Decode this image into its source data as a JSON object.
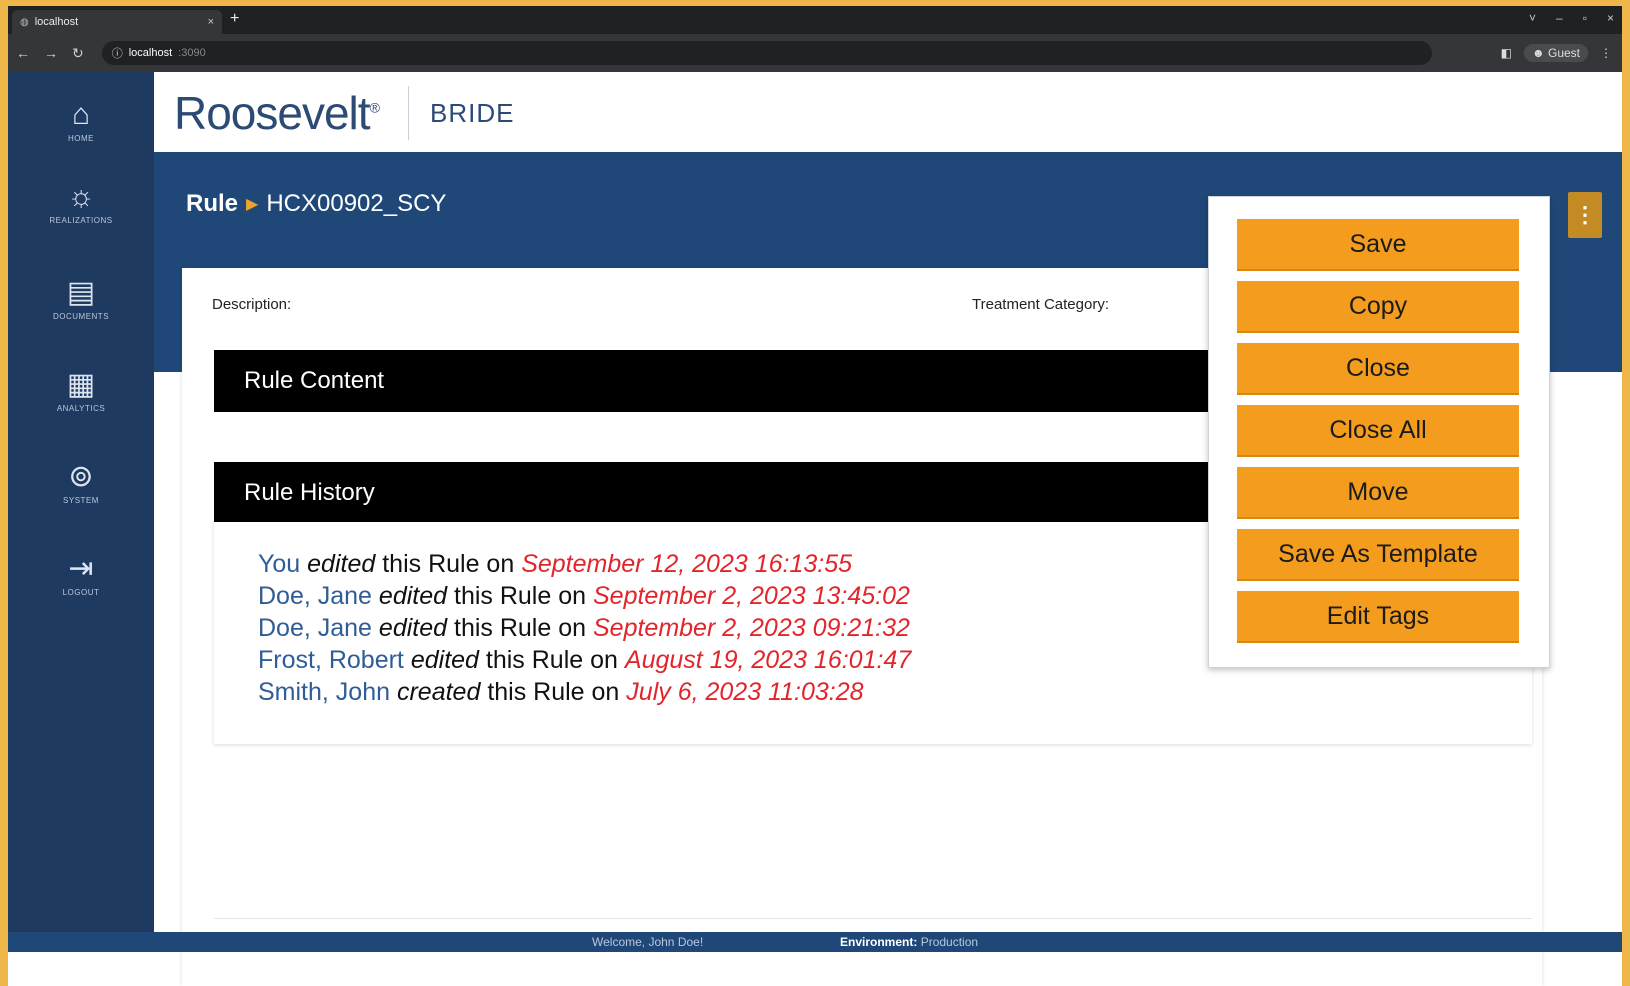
{
  "browser": {
    "tab_title": "localhost",
    "new_tab": "+",
    "close_tab": "×",
    "address_host": "localhost",
    "address_port": ":3090",
    "profile": "Guest",
    "window_controls": [
      "˅",
      "–",
      "▫",
      "×"
    ]
  },
  "sidebar": {
    "items": [
      {
        "icon": "home-icon",
        "glyph": "⌂",
        "label": "HOME"
      },
      {
        "icon": "lightbulb-icon",
        "glyph": "☼",
        "label": "REALIZATIONS"
      },
      {
        "icon": "document-icon",
        "glyph": "▤",
        "label": "DOCUMENTS"
      },
      {
        "icon": "analytics-icon",
        "glyph": "▦",
        "label": "ANALYTICS"
      },
      {
        "icon": "system-icon",
        "glyph": "⊚",
        "label": "SYSTEM"
      },
      {
        "icon": "logout-icon",
        "glyph": "⇥",
        "label": "LOGOUT"
      }
    ]
  },
  "header": {
    "logo": "Roosevelt",
    "logo_mark": "®",
    "product": "BRIDE"
  },
  "breadcrumb": {
    "root": "Rule",
    "arrow": "▶",
    "current": "HCX00902_SCY"
  },
  "kebab": "⋮",
  "card": {
    "description_label": "Description:",
    "treatment_label": "Treatment Category:",
    "rule_content_title": "Rule Content",
    "rule_history_title": "Rule History"
  },
  "history": [
    {
      "who": "You",
      "action": "edited",
      "middle": "this Rule on",
      "when": "September 12, 2023  16:13:55"
    },
    {
      "who": "Doe, Jane",
      "action": "edited",
      "middle": "this Rule on",
      "when": "September 2, 2023  13:45:02"
    },
    {
      "who": "Doe, Jane",
      "action": "edited",
      "middle": "this Rule on",
      "when": "September 2, 2023  09:21:32"
    },
    {
      "who": "Frost, Robert",
      "action": "edited",
      "middle": "this Rule on",
      "when": "August 19, 2023  16:01:47"
    },
    {
      "who": "Smith, John",
      "action": "created",
      "middle": "this Rule on",
      "when": "July 6, 2023  11:03:28"
    }
  ],
  "menu": {
    "items": [
      "Save",
      "Copy",
      "Close",
      "Close All",
      "Move",
      "Save As Template",
      "Edit Tags"
    ]
  },
  "footer": {
    "welcome": "Welcome, John Doe!",
    "env_label": "Environment:",
    "env_value": "Production"
  },
  "colors": {
    "sidebar": "#1f3a60",
    "banner": "#1f4879",
    "accent_orange": "#f39c1d",
    "link_blue": "#2f5d97",
    "date_red": "#e2252b"
  }
}
